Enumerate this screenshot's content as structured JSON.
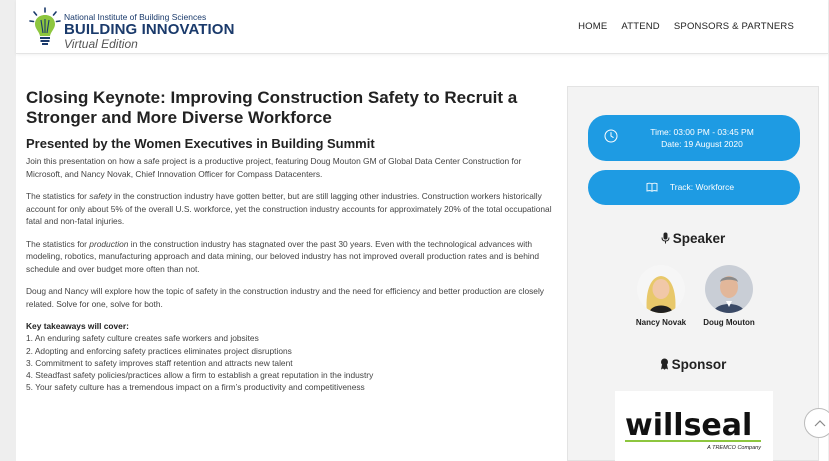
{
  "header": {
    "logo_line1": "National Institute of Building Sciences",
    "logo_line2": "BUILDING INNOVATION",
    "logo_line3": "Virtual Edition",
    "nav": [
      "HOME",
      "ATTEND",
      "SPONSORS & PARTNERS"
    ]
  },
  "main": {
    "title": "Closing Keynote: Improving Construction Safety to Recruit a Stronger and More Diverse Workforce",
    "subtitle": "Presented by the Women Executives in Building Summit",
    "p1": "Join this presentation on how a safe project is a productive project, featuring Doug Mouton GM of Global Data Center Construction for Microsoft, and Nancy Novak, Chief Innovation Officer for Compass Datacenters.",
    "p2_a": "The statistics for ",
    "p2_em": "safety",
    "p2_b": " in the construction industry have gotten better, but are still lagging other industries. Construction workers historically account for only about 5% of the overall U.S. workforce, yet the construction industry accounts for approximately 20% of the total occupational fatal and non-fatal injuries.",
    "p3_a": "The statistics for ",
    "p3_em": "production",
    "p3_b": " in the construction industry has stagnated over the past 30 years.  Even with the technological advances with modeling, robotics, manufacturing approach and data mining, our beloved industry has not improved overall production rates and is behind schedule and over budget more often than not.",
    "p4": "Doug and Nancy will explore how the topic of safety in the construction industry and the need for efficiency and better production are closely related.  Solve for one, solve for both.",
    "takeaways_heading": "Key takeaways will cover:",
    "takeaways": [
      "1.  An enduring safety culture creates safe workers and jobsites",
      "2.  Adopting and enforcing safety practices eliminates project disruptions",
      "3.  Commitment to safety improves staff retention and attracts new talent",
      "4.  Steadfast safety policies/practices allow a firm to establish a great reputation in the industry",
      "5.  Your safety culture has a tremendous impact on a firm’s productivity and competitiveness"
    ]
  },
  "sidebar": {
    "time": "Time: 03:00 PM - 03:45 PM",
    "date": "Date: 19 August 2020",
    "track": "Track: Workforce",
    "speaker_heading": "Speaker",
    "speakers": [
      "Nancy Novak",
      "Doug Mouton"
    ],
    "sponsor_heading": "Sponsor",
    "sponsor_logo_text": "willseal",
    "sponsor_logo_sub": "A TREMCO Company"
  },
  "colors": {
    "accent": "#1e9be3",
    "logo_navy": "#1a3a6b",
    "sponsor_green": "#8dc63f"
  }
}
